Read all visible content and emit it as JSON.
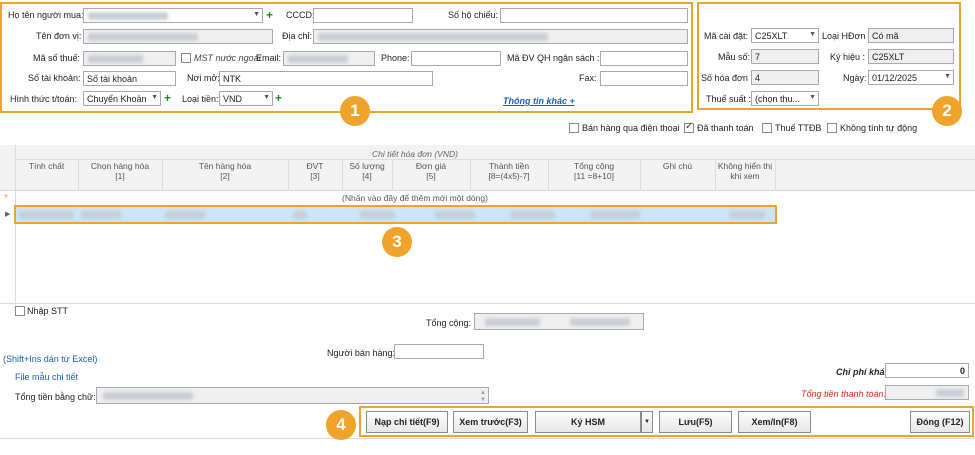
{
  "buyer": {
    "buyer_name_label": "Họ tên người mua:",
    "cccd_label": "CCCD:",
    "passport_label": "Số hộ chiếu:",
    "unit_name_label": "Tên đơn vị:",
    "address_label": "Địa chỉ:",
    "tax_code_label": "Mã số thuế:",
    "foreign_tax_label": "MST nước ngoài",
    "email_label": "Email:",
    "phone_label": "Phone:",
    "budget_code_label": "Mã ĐV QH ngân sách :",
    "account_label": "Số tài khoản:",
    "account_value": "Số tài khoản",
    "bank_label": "Nơi mở:",
    "bank_value": "NTK",
    "fax_label": "Fax:",
    "payment_label": "Hình thức t/toán:",
    "payment_value": "Chuyển Khoản",
    "currency_label": "Loại tiền:",
    "currency_value": "VND",
    "more_info_link": "Thông tin khác +"
  },
  "invoice": {
    "setup_code_label": "Mã cài đặt:",
    "setup_code_value": "C25XLT",
    "invoice_type_label": "Loại HĐơn :",
    "invoice_type_value": "Có mã",
    "form_no_label": "Mẫu số:",
    "form_no_value": "7",
    "symbol_label": "Ký hiệu :",
    "symbol_value": "C25XLT",
    "invoice_no_label": "Số hóa đơn :",
    "invoice_no_value": "4",
    "date_label": "Ngày:",
    "date_value": "01/12/2025",
    "tax_rate_label": "Thuế suất :",
    "tax_rate_value": "(chọn thu..."
  },
  "options": {
    "phone_sale": "Bán hàng qua điện thoại",
    "paid": "Đã thanh toán",
    "special_tax": "Thuế TTĐB",
    "no_auto": "Không tính tự động"
  },
  "grid": {
    "group_title": "Chi tiết hóa đơn (VND)",
    "columns": [
      {
        "label": "Tính chất",
        "sub": ""
      },
      {
        "label": "Chọn hàng hóa",
        "sub": "[1]"
      },
      {
        "label": "Tên hàng hóa",
        "sub": "[2]"
      },
      {
        "label": "ĐVT",
        "sub": "[3]"
      },
      {
        "label": "Số lượng",
        "sub": "[4]"
      },
      {
        "label": "Đơn giá",
        "sub": "[5]"
      },
      {
        "label": "Thành tiền",
        "sub": "[8=(4x5)-7]"
      },
      {
        "label": "Tổng cộng",
        "sub": "[11 =8+10]"
      },
      {
        "label": "Ghi chú",
        "sub": ""
      },
      {
        "label": "Không hiển thị",
        "sub": "khi xem"
      }
    ],
    "new_row_hint": "(Nhấn vào đây để thêm mới một dòng)"
  },
  "bottom": {
    "enter_stt": "Nhập STT",
    "total_label": "Tổng cộng:",
    "seller_label": "Người bán hàng:",
    "paste_excel": "(Shift+Ins dán từ Excel)",
    "sample_file": "File mẫu chi tiết",
    "amount_words_label": "Tổng tiền bằng chữ:",
    "other_fee_label": "Chi phí khác:",
    "other_fee_value": "0",
    "grand_total_label": "Tổng tiền thanh toán:"
  },
  "buttons": {
    "load_detail": "Nạp chi tiết(F9)",
    "preview": "Xem trước(F3)",
    "sign_hsm": "Ký HSM",
    "save": "Lưu(F5)",
    "view_print": "Xem/In(F8)",
    "close": "Đóng (F12)"
  },
  "badges": [
    "1",
    "2",
    "3",
    "4"
  ],
  "colors": {
    "accent": "#f0a32a",
    "link": "#1a5fb4",
    "selected_row": "#cfe3f7",
    "red_label": "#d9261c"
  }
}
